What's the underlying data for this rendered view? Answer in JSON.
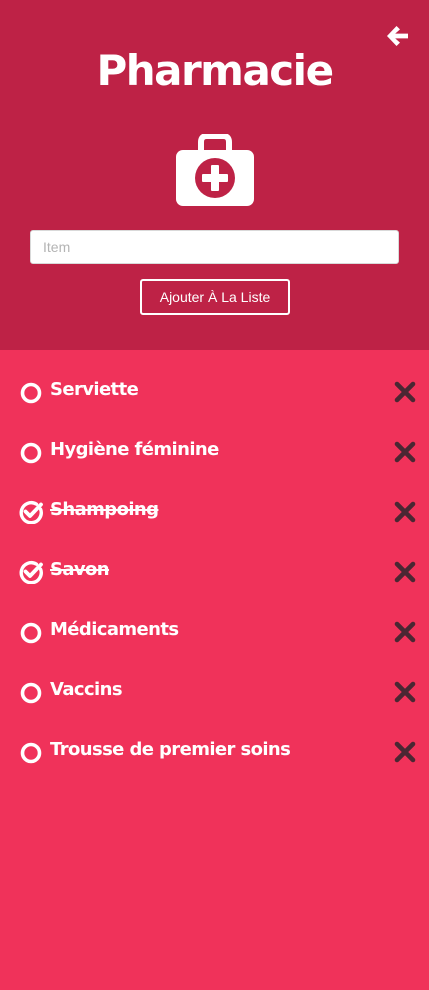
{
  "header": {
    "title": "Pharmacie",
    "back_icon": "arrow-left-icon",
    "category_icon": "first-aid-kit-icon"
  },
  "form": {
    "placeholder": "Item",
    "value": "",
    "add_label": "Ajouter À La Liste"
  },
  "colors": {
    "header_bg": "#be2246",
    "list_bg": "#f0325a",
    "text": "#ffffff",
    "delete_icon": "#4a2733"
  },
  "items": [
    {
      "label": "Serviette",
      "done": false,
      "check_icon": "circle-icon",
      "delete_icon": "close-icon"
    },
    {
      "label": "Hygiène féminine",
      "done": false,
      "check_icon": "circle-icon",
      "delete_icon": "close-icon"
    },
    {
      "label": "Shampoing",
      "done": true,
      "check_icon": "check-circle-icon",
      "delete_icon": "close-icon"
    },
    {
      "label": "Savon",
      "done": true,
      "check_icon": "check-circle-icon",
      "delete_icon": "close-icon"
    },
    {
      "label": "Médicaments",
      "done": false,
      "check_icon": "circle-icon",
      "delete_icon": "close-icon"
    },
    {
      "label": "Vaccins",
      "done": false,
      "check_icon": "circle-icon",
      "delete_icon": "close-icon"
    },
    {
      "label": "Trousse de premier soins",
      "done": false,
      "check_icon": "circle-icon",
      "delete_icon": "close-icon"
    }
  ]
}
